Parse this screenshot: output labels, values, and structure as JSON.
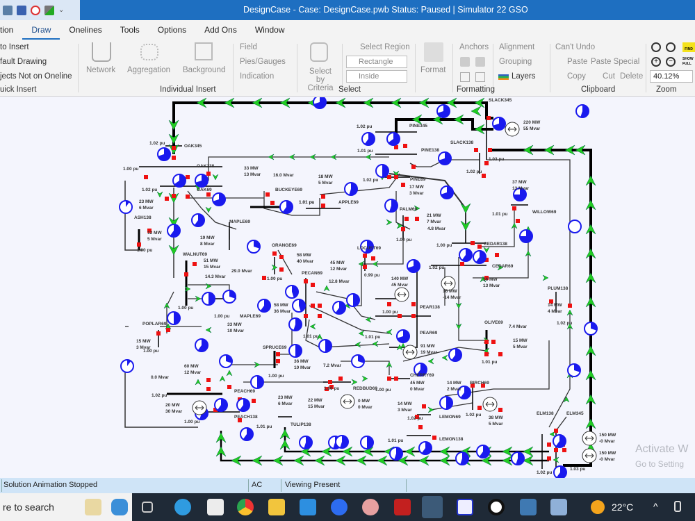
{
  "window": {
    "title": "DesignCase - Case: DesignCase.pwb  Status: Paused | Simulator 22 GSO"
  },
  "quick_access": {
    "icons": [
      "case-info-icon",
      "calculator-icon",
      "abort-icon",
      "contour-icon",
      "customize-chevron-icon"
    ]
  },
  "tabs": [
    {
      "label": "tion",
      "active": false
    },
    {
      "label": "Draw",
      "active": true
    },
    {
      "label": "Onelines",
      "active": false
    },
    {
      "label": "Tools",
      "active": false
    },
    {
      "label": "Options",
      "active": false
    },
    {
      "label": "Add Ons",
      "active": false
    },
    {
      "label": "Window",
      "active": false
    }
  ],
  "ribbon": {
    "quick_insert": {
      "items": [
        "to Insert",
        "fault Drawing",
        "jects Not on Oneline"
      ],
      "group": "uick Insert"
    },
    "individual_insert": {
      "network": "Network",
      "aggregation": "Aggregation",
      "background": "Background",
      "field": "Field",
      "pies_gauges": "Pies/Gauges",
      "indication": "Indication",
      "group": "Individual Insert"
    },
    "select": {
      "select_by_criteria": "Select by Criteria",
      "select_region": "Select Region",
      "shape_value": "Rectangle",
      "mode_value": "Inside",
      "group": "Select"
    },
    "formatting": {
      "format": "Format",
      "anchors": "Anchors",
      "alignment": "Alignment",
      "grouping": "Grouping",
      "layers": "Layers",
      "group": "Formatting"
    },
    "clipboard": {
      "undo": "Can't Undo",
      "paste": "Paste",
      "paste_special": "Paste Special",
      "copy": "Copy",
      "cut": "Cut",
      "delete": "Delete",
      "group": "Clipboard"
    },
    "zoom": {
      "value": "40.12%",
      "find": "FIND",
      "show_full": "SHOW FULL",
      "group": "Zoom"
    }
  },
  "oneline": {
    "buses": [
      {
        "name": "OAK345",
        "pu": "1.02 pu"
      },
      {
        "name": "OAK138",
        "pu": "1.00 pu"
      },
      {
        "name": "OAK69",
        "pu": "1.02 pu"
      },
      {
        "name": "ASH138",
        "pu": "1.00 pu"
      },
      {
        "name": "BUCKEYE69",
        "pu": "1.01 pu"
      },
      {
        "name": "APPLE69",
        "pu": "1.01 pu"
      },
      {
        "name": "MAPLE69",
        "pu": ""
      },
      {
        "name": "ORANGE69",
        "pu": "1.00 pu"
      },
      {
        "name": "WALNUT69",
        "pu": "1.00 pu"
      },
      {
        "name": "MAPLE69",
        "pu": "1.00 pu"
      },
      {
        "name": "POPLAR69",
        "pu": "1.00 pu"
      },
      {
        "name": "PECAN69",
        "pu": "1.01 pu"
      },
      {
        "name": "SPRUCE69",
        "pu": "1.00 pu"
      },
      {
        "name": "PEACH69",
        "pu": "1.02 pu"
      },
      {
        "name": "PEACH138",
        "pu": "1.00 pu"
      },
      {
        "name": "TULIP138",
        "pu": "1.01 pu"
      },
      {
        "name": "REDBUD69",
        "pu": "1.00 pu"
      },
      {
        "name": "PINE345",
        "pu": "1.02 pu"
      },
      {
        "name": "PINE138",
        "pu": "1.01 pu"
      },
      {
        "name": "PINE69",
        "pu": "1.02 pu"
      },
      {
        "name": "PALM69",
        "pu": "1.00 pu"
      },
      {
        "name": "LOCUST69",
        "pu": "0.99 pu"
      },
      {
        "name": "SLACK345",
        "pu": "1.03 pu"
      },
      {
        "name": "SLACK138",
        "pu": "1.02 pu"
      },
      {
        "name": "CEDAR138",
        "pu": "1.00 pu"
      },
      {
        "name": "CEDAR69",
        "pu": "1.02 pu"
      },
      {
        "name": "WILLOW69",
        "pu": "1.01 pu"
      },
      {
        "name": "PLUM138",
        "pu": "1.02 pu"
      },
      {
        "name": "PEAR138",
        "pu": "1.00 pu"
      },
      {
        "name": "PEAR69",
        "pu": "1.01 pu"
      },
      {
        "name": "OLIVE69",
        "pu": "1.01 pu"
      },
      {
        "name": "CHERRY69",
        "pu": "1.00 pu"
      },
      {
        "name": "BIRCH69",
        "pu": "1.02 pu"
      },
      {
        "name": "LEMON69",
        "pu": "1.02 pu"
      },
      {
        "name": "LEMON138",
        "pu": "1.01 pu"
      },
      {
        "name": "ELM138",
        "pu": "1.02 pu"
      },
      {
        "name": "ELM345",
        "pu": "1.03 pu"
      }
    ],
    "loads": [
      {
        "bus": "OAK69",
        "mw": "23 MW",
        "mvar": "6 Mvar"
      },
      {
        "bus": "ASH138",
        "mw": "12 MW",
        "mvar": "5 Mvar"
      },
      {
        "bus": "BUCKEYE69",
        "mw": "33 MW",
        "mvar": "13 Mvar"
      },
      {
        "bus": "APPLE69",
        "mw": "18 MW",
        "mvar": "5 Mvar"
      },
      {
        "bus": "MAPLE69",
        "mw": "19 MW",
        "mvar": "8 Mvar"
      },
      {
        "bus": "ORANGE69",
        "mw": "58 MW",
        "mvar": "40 Mvar"
      },
      {
        "bus": "WALNUT69",
        "mw": "51 MW",
        "mvar": "15 Mvar"
      },
      {
        "bus": "MAPLE69b",
        "mw": "33 MW",
        "mvar": "10 Mvar"
      },
      {
        "bus": "POPLAR69",
        "mw": "15 MW",
        "mvar": "3 Mvar"
      },
      {
        "bus": "PECAN69",
        "mw": "58 MW",
        "mvar": "36 Mvar"
      },
      {
        "bus": "SPRUCE69",
        "mw": "36 MW",
        "mvar": "10 Mvar"
      },
      {
        "bus": "PEACH69",
        "mw": "60 MW",
        "mvar": "12 Mvar"
      },
      {
        "bus": "TULIP138",
        "mw": "23 MW",
        "mvar": "6 Mvar"
      },
      {
        "bus": "REDBUD69",
        "mw": "22 MW",
        "mvar": "15 Mvar"
      },
      {
        "bus": "PINE69",
        "mw": "17 MW",
        "mvar": "3 Mvar"
      },
      {
        "bus": "PALM69",
        "mw": "21 MW",
        "mvar": "7 Mvar"
      },
      {
        "bus": "LOCUST69",
        "mw": "45 MW",
        "mvar": "12 Mvar"
      },
      {
        "bus": "CEDAR69",
        "mw": "56 MW",
        "mvar": "13 Mvar"
      },
      {
        "bus": "WILLOW69",
        "mw": "37 MW",
        "mvar": "13 Mvar"
      },
      {
        "bus": "PLUM138",
        "mw": "14 MW",
        "mvar": "4 Mvar"
      },
      {
        "bus": "OLIVE69",
        "mw": "15 MW",
        "mvar": "5 Mvar"
      },
      {
        "bus": "CHERRY69",
        "mw": "45 MW",
        "mvar": "0 Mvar"
      },
      {
        "bus": "BIRCH69",
        "mw": "14 MW",
        "mvar": "2 Mvar"
      },
      {
        "bus": "LEMON69",
        "mw": "14 MW",
        "mvar": "3 Mvar"
      }
    ],
    "generators": [
      {
        "bus": "SLACK345",
        "mw": "220 MW",
        "mvar": "55 Mvar"
      },
      {
        "bus": "PEAR138",
        "mw": "140 MW",
        "mvar": "45 Mvar"
      },
      {
        "bus": "CEDAR69",
        "mw": "16 MW",
        "mvar": "-14 Mvar"
      },
      {
        "bus": "PEAR69",
        "mw": "91 MW",
        "mvar": "19 Mvar"
      },
      {
        "bus": "PEACH69",
        "mw": "20 MW",
        "mvar": "30 Mvar"
      },
      {
        "bus": "REDBUD69",
        "mw": "0 MW",
        "mvar": "0 Mvar"
      },
      {
        "bus": "BIRCH69",
        "mw": "38 MW",
        "mvar": "5 Mvar"
      },
      {
        "bus": "ELM345a",
        "mw": "150 MW",
        "mvar": "-0 Mvar"
      },
      {
        "bus": "ELM345b",
        "mw": "150 MW",
        "mvar": "-0 Mvar"
      }
    ],
    "shunts": [
      {
        "bus": "BUCKEYE69",
        "mvar": "16.0 Mvar"
      },
      {
        "bus": "PALM69",
        "mvar": "4.8 Mvar"
      },
      {
        "bus": "WALNUT69",
        "mvar": "14.3 Mvar"
      },
      {
        "bus": "ORANGE69",
        "mvar": "29.0 Mvar"
      },
      {
        "bus": "PECAN69",
        "mvar": "12.8 Mvar"
      },
      {
        "bus": "REDBUD69",
        "mvar": "7.2 Mvar"
      },
      {
        "bus": "PEACH69",
        "mvar": "0.0 Mvar"
      },
      {
        "bus": "OLIVE69",
        "mvar": "7.4 Mvar"
      }
    ]
  },
  "status": {
    "message": "Solution Animation Stopped",
    "mode": "AC",
    "viewing": "Viewing Present"
  },
  "watermark": {
    "line1": "Activate W",
    "line2": "Go to Setting"
  },
  "taskbar": {
    "search_placeholder": "re to search",
    "temperature": "22°C",
    "apps": [
      "task-view-icon",
      "edge-icon",
      "store-icon",
      "chrome-icon",
      "file-explorer-icon",
      "mail-icon",
      "zoom-icon",
      "snipping-icon",
      "acrobat-icon",
      "powerworld-icon",
      "app-icon",
      "github-icon",
      "python-icon",
      "remote-desktop-icon"
    ]
  },
  "colors": {
    "title_bar": "#1e6fc1",
    "flow_arrow": "#22cc22",
    "breaker": "#ee1111",
    "pie_chart": "#1a1aee",
    "line": "#111111"
  }
}
